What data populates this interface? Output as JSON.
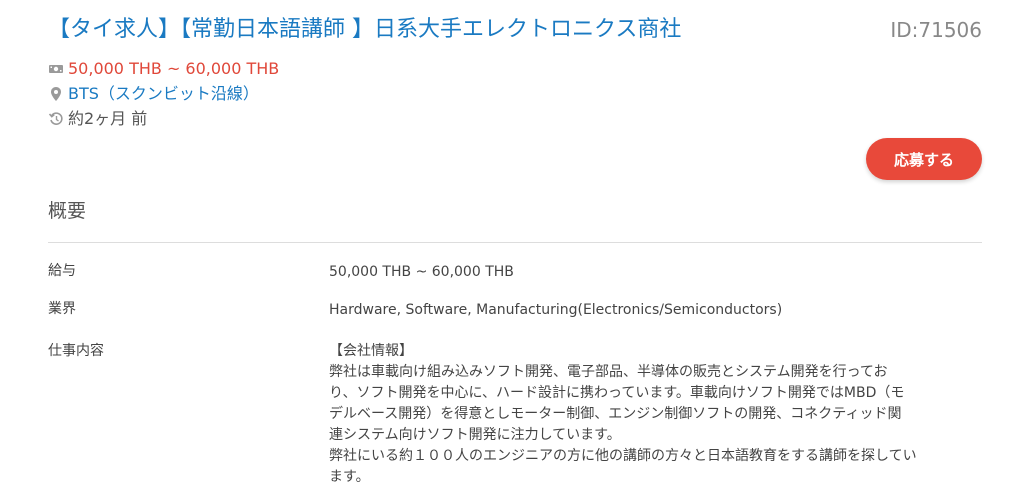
{
  "job": {
    "title": "【タイ求人】【常勤日本語講師 】日系大手エレクトロニクス商社",
    "id_text": "ID:71506",
    "salary": "50,000 THB ~ 60,000 THB",
    "location": "BTS（スクンビット沿線）",
    "posted": "約2ヶ月 前",
    "apply_label": "応募する"
  },
  "icons": {
    "salary": "money-icon",
    "location": "map-pin-icon",
    "time": "history-icon"
  },
  "overview": {
    "title": "概要",
    "rows": [
      {
        "label": "給与",
        "value": "50,000 THB ~ 60,000 THB"
      },
      {
        "label": "業界",
        "value": "Hardware, Software, Manufacturing(Electronics/Semiconductors)"
      },
      {
        "label": "仕事内容",
        "lines": [
          "【会社情報】",
          "弊社は車載向け組み込みソフト開発、電子部品、半導体の販売とシステム開発を行ってお",
          "り、ソフト開発を中心に、ハード設計に携わっています。車載向けソフト開発ではMBD（モ",
          "デルベース開発）を得意としモーター制御、エンジン制御ソフトの開発、コネクティッド関",
          "連システム向けソフト開発に注力しています。",
          "弊社にいる約１００人のエンジニアの方に他の講師の方々と日本語教育をする講師を探してい",
          "ます。"
        ]
      }
    ]
  },
  "colors": {
    "title_blue": "#1a7ac2",
    "salary_red": "#e0483a",
    "apply_button": "#e8493a",
    "id_gray": "#888888"
  }
}
